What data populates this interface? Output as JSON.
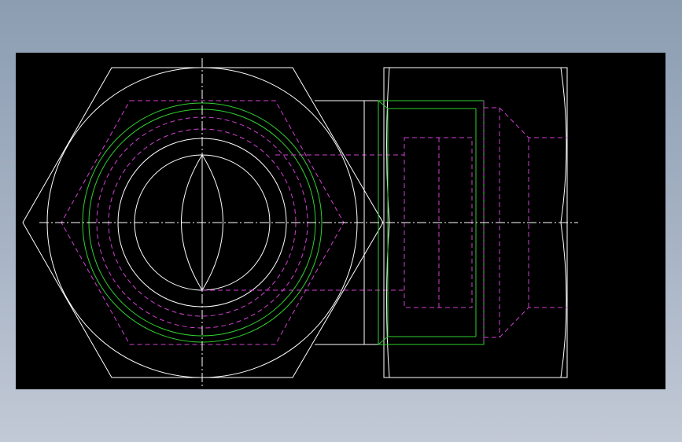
{
  "colors": {
    "background_top": "#8c9db2",
    "background_bottom": "#c2c9d6",
    "viewport": "#000000",
    "outline": "#ffffff",
    "hidden": "#d040d0",
    "thread": "#30d030",
    "centerline": "#ffffff"
  },
  "icons": {
    "front_view": "hex-nut-front-view",
    "side_view": "hex-nut-side-view"
  }
}
